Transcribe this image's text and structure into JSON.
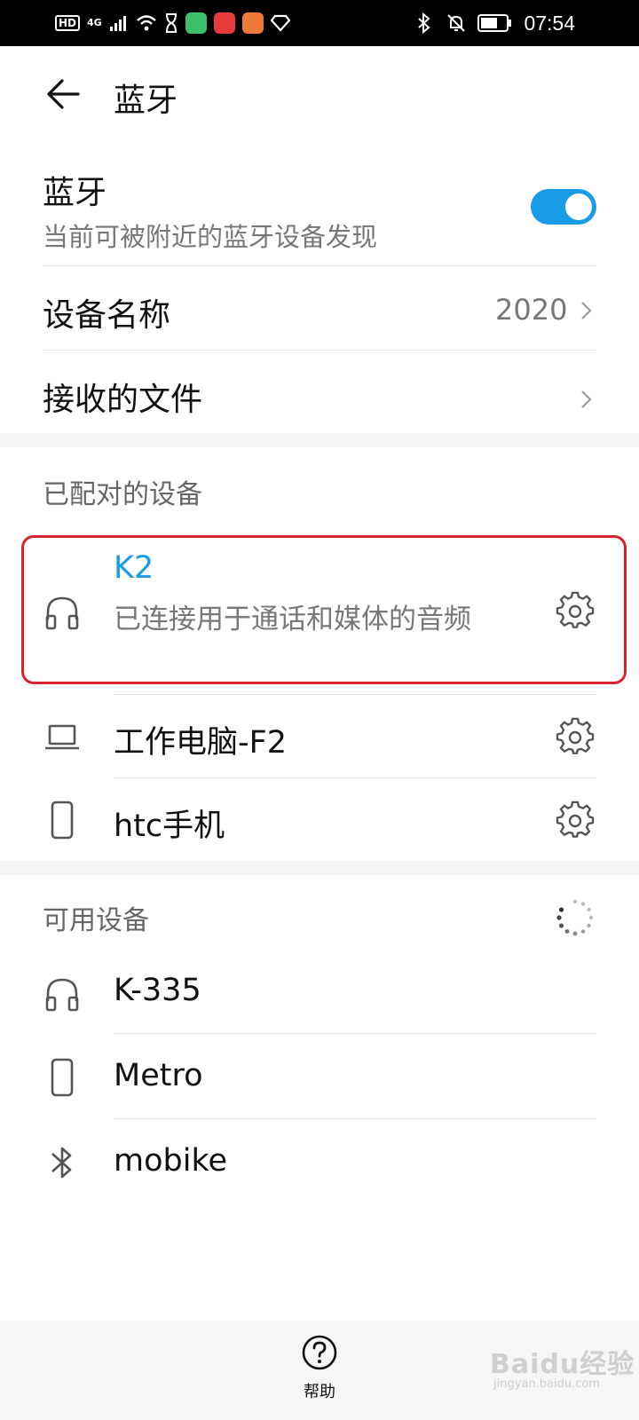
{
  "status_bar": {
    "hd": "HD",
    "network": "4G",
    "time": "07:54"
  },
  "header": {
    "title": "蓝牙"
  },
  "bluetooth": {
    "label": "蓝牙",
    "subtitle": "当前可被附近的蓝牙设备发现",
    "enabled": true,
    "accent_color": "#1a9be8"
  },
  "device_name": {
    "label": "设备名称",
    "value": "2020"
  },
  "received_files": {
    "label": "接收的文件"
  },
  "paired": {
    "section_title": "已配对的设备",
    "devices": [
      {
        "name": "K2",
        "status": "已连接用于通话和媒体的音频",
        "icon": "headphones-icon"
      },
      {
        "name": "工作电脑-F2",
        "icon": "laptop-icon"
      },
      {
        "name": "htc手机",
        "icon": "phone-icon"
      }
    ]
  },
  "available": {
    "section_title": "可用设备",
    "devices": [
      {
        "name": "K-335",
        "icon": "headphones-icon"
      },
      {
        "name": "Metro",
        "icon": "phone-icon"
      },
      {
        "name": "mobike",
        "icon": "bluetooth-icon"
      }
    ]
  },
  "bottom": {
    "help_label": "帮助"
  },
  "watermark": {
    "text": "Baidu经验",
    "url": "jingyan.baidu.com"
  }
}
